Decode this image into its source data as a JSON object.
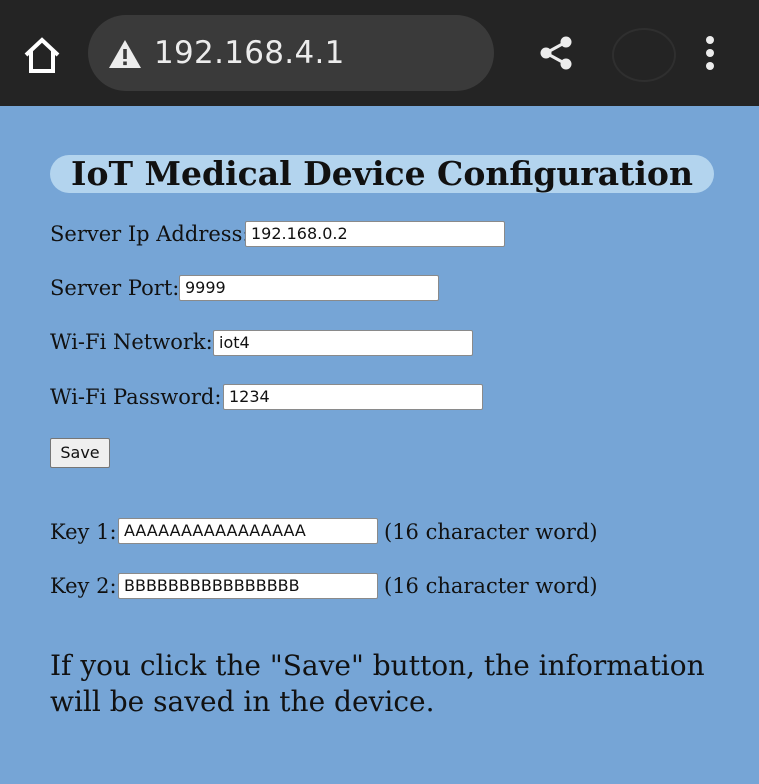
{
  "browser": {
    "url": "192.168.4.1",
    "icons": {
      "home": "home-icon",
      "warning": "warning-icon",
      "share": "share-icon",
      "menu": "more-vert-icon"
    }
  },
  "page": {
    "title": "IoT Medical Device Configuration",
    "fields": {
      "server_ip": {
        "label": "Server Ip Address:",
        "value": "192.168.0.2"
      },
      "server_port": {
        "label": "Server Port:",
        "value": "9999"
      },
      "wifi_network": {
        "label": "Wi-Fi Network:",
        "value": "iot4"
      },
      "wifi_password": {
        "label": "Wi-Fi Password:",
        "value": "1234"
      }
    },
    "save_label": "Save",
    "keys": {
      "key1": {
        "label": "Key 1:",
        "value": "AAAAAAAAAAAAAAAA",
        "hint": "(16 character word)"
      },
      "key2": {
        "label": "Key 2:",
        "value": "BBBBBBBBBBBBBBBB",
        "hint": "(16 character word)"
      }
    },
    "note": "If you click the \"Save\" button, the information will be saved in the device."
  },
  "colors": {
    "page_background": "#76a5d6",
    "title_background": "#b3d4ee",
    "toolbar_background": "#242424",
    "url_box_background": "#3a3a3a"
  }
}
